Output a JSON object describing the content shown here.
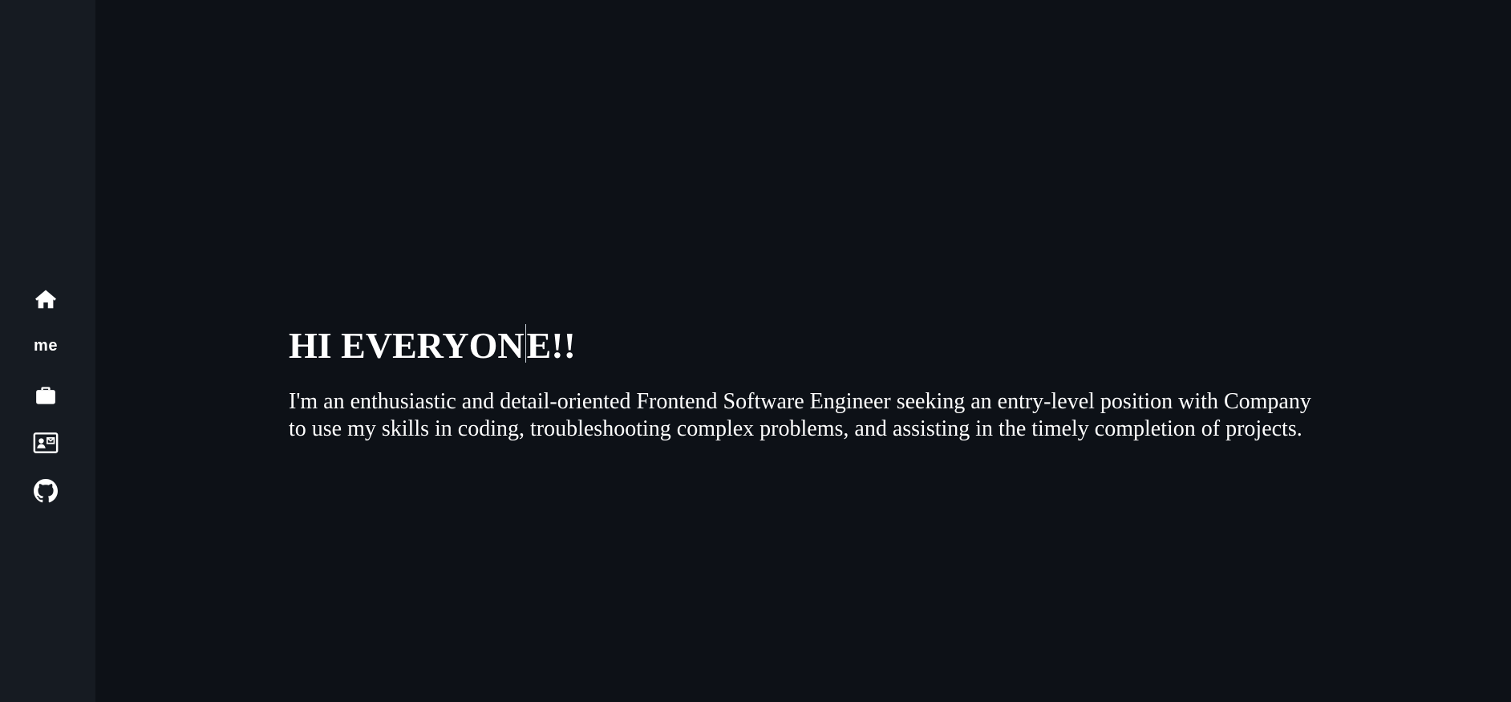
{
  "sidebar": {
    "items": [
      {
        "name": "home",
        "icon": "home-icon"
      },
      {
        "name": "me",
        "label": "me"
      },
      {
        "name": "work",
        "icon": "briefcase-icon"
      },
      {
        "name": "contact",
        "icon": "contact-card-icon"
      },
      {
        "name": "github",
        "icon": "github-icon"
      }
    ]
  },
  "main": {
    "headline_before_caret": "HI EVERYON",
    "headline_after_caret": "E!!",
    "intro": "I'm an enthusiastic and detail-oriented Frontend Software Engineer seeking an entry-level position with Company to use my skills in coding, troubleshooting complex problems, and assisting in the timely completion of projects."
  },
  "colors": {
    "background": "#0d1117",
    "sidebar": "#161b22",
    "text": "#ffffff"
  }
}
